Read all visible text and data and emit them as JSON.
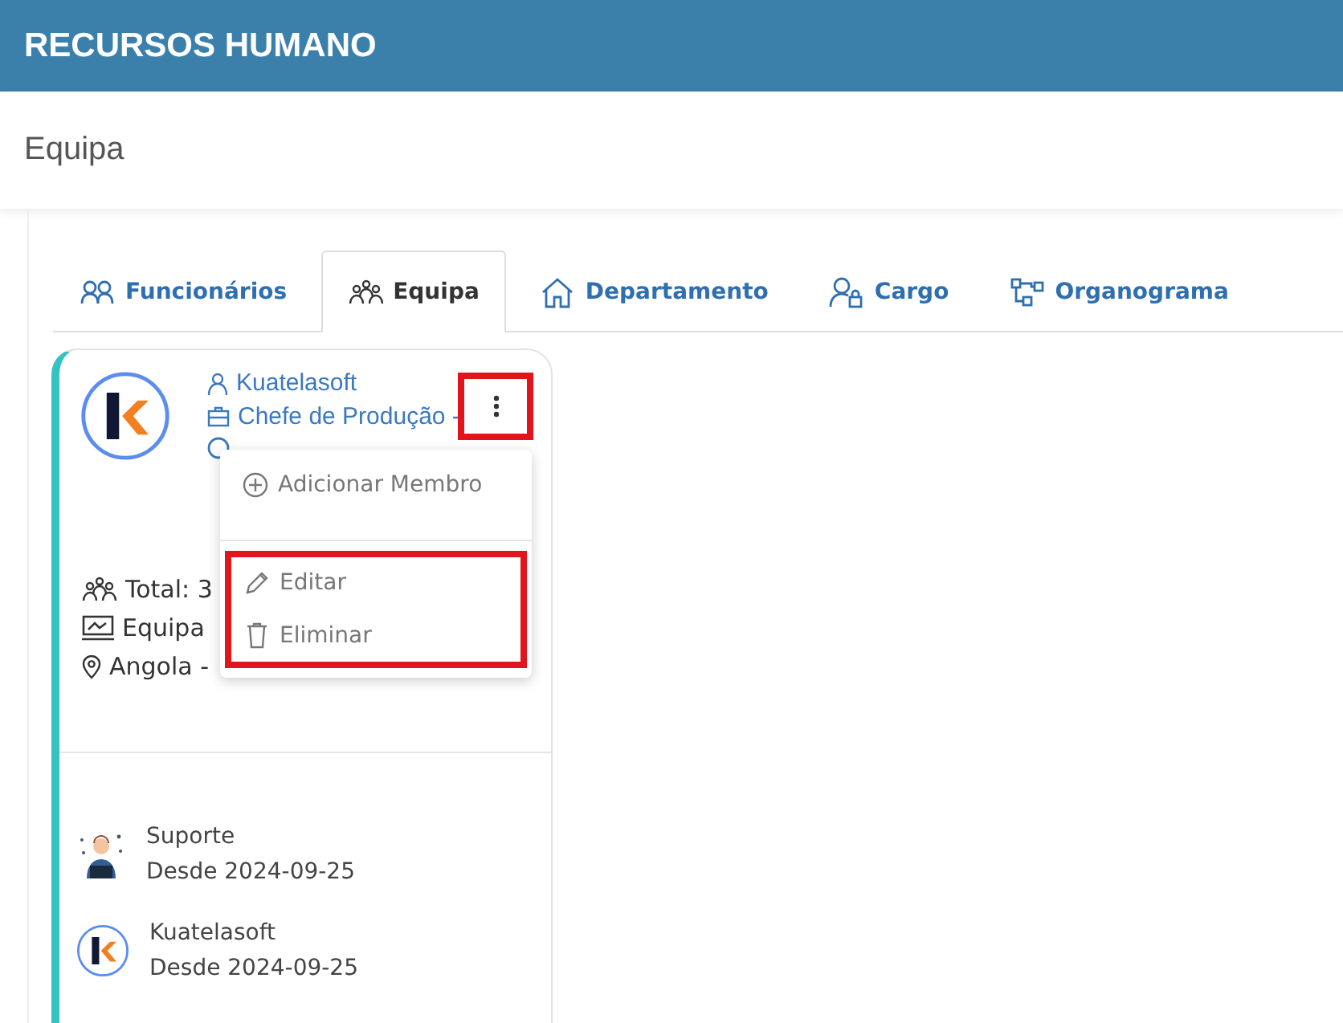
{
  "header": {
    "title": "RECURSOS HUMANO"
  },
  "page": {
    "title": "Equipa"
  },
  "tabs": [
    {
      "label": "Funcionários",
      "selected": false
    },
    {
      "label": "Equipa",
      "selected": true
    },
    {
      "label": "Departamento",
      "selected": false
    },
    {
      "label": "Cargo",
      "selected": false
    },
    {
      "label": "Organograma",
      "selected": false
    }
  ],
  "team_card": {
    "name": "Kuatelasoft",
    "role": "Chefe de Produção -",
    "total": "Total: 3",
    "type": "Equipa",
    "location": "Angola -",
    "menu": {
      "items": [
        {
          "label": "Adicionar Membro",
          "highlighted": false
        },
        {
          "label": "Editar",
          "highlighted": true
        },
        {
          "label": "Eliminar",
          "highlighted": true
        }
      ]
    },
    "members": [
      {
        "name": "Suporte",
        "since": "Desde 2024-09-25",
        "kind": "agent"
      },
      {
        "name": "Kuatelasoft",
        "since": "Desde 2024-09-25",
        "kind": "logo"
      }
    ]
  }
}
